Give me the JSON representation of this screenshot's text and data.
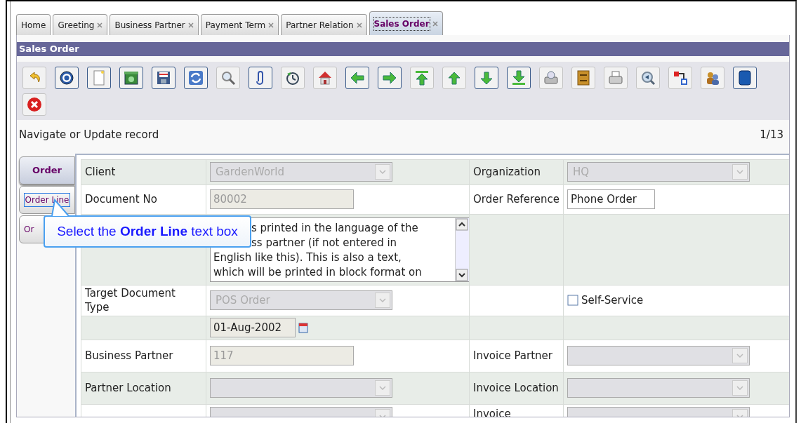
{
  "tabs": [
    {
      "label": "Home",
      "closable": false,
      "selected": false
    },
    {
      "label": "Greeting",
      "closable": true,
      "selected": false
    },
    {
      "label": "Business Partner",
      "closable": true,
      "selected": false
    },
    {
      "label": "Payment Term",
      "closable": true,
      "selected": false
    },
    {
      "label": "Partner Relation",
      "closable": true,
      "selected": false
    },
    {
      "label": "Sales Order",
      "closable": true,
      "selected": true
    }
  ],
  "window": {
    "title": "Sales Order"
  },
  "status": {
    "message": "Navigate or Update record",
    "record": "1/13"
  },
  "side_tabs": [
    {
      "label": "Order",
      "selected": true,
      "focused": false
    },
    {
      "label": "Order Line",
      "selected": false,
      "focused": true
    },
    {
      "label": "Or",
      "selected": false,
      "focused": false
    }
  ],
  "tooltip": {
    "text": "Select the **Order Line** text box"
  },
  "form": {
    "rows": [
      {
        "label": "Client",
        "field": {
          "kind": "select",
          "value": "GardenWorld",
          "disabled": true
        },
        "label_2": "Organization",
        "field_2": {
          "kind": "select",
          "value": "HQ",
          "disabled": true
        }
      },
      {
        "label": "Document No",
        "field": {
          "kind": "text",
          "value": "80002",
          "disabled": true
        },
        "label_2": "Order Reference",
        "field_2": {
          "kind": "text",
          "value": "Phone Order",
          "disabled": false
        }
      },
      {
        "field": {
          "kind": "textarea",
          "lines": [
            "s printed in the language of the",
            "ss partner (if not entered in",
            "English like this). This is also a text,",
            "which will be printed in block format on"
          ]
        }
      },
      {
        "label": "Target Document Type",
        "field": {
          "kind": "select",
          "value": "POS Order",
          "disabled": true
        },
        "field_2": {
          "kind": "checkbox",
          "label": "Self-Service",
          "checked": false
        }
      },
      {
        "field": {
          "kind": "date",
          "value": "01-Aug-2002"
        }
      },
      {
        "label": "Business Partner",
        "field": {
          "kind": "text",
          "value": "117",
          "disabled": true
        },
        "label_2": "Invoice Partner",
        "field_2": {
          "kind": "select",
          "disabled": true
        }
      },
      {
        "label": "Partner Location",
        "field": {
          "kind": "select",
          "disabled": true
        },
        "label_2": "Invoice Location",
        "field_2": {
          "kind": "select",
          "disabled": true
        }
      },
      {
        "field": {
          "kind": "select",
          "disabled": true
        },
        "label_2": "Invoice",
        "field_2": {
          "kind": "select",
          "disabled": true
        }
      }
    ]
  }
}
